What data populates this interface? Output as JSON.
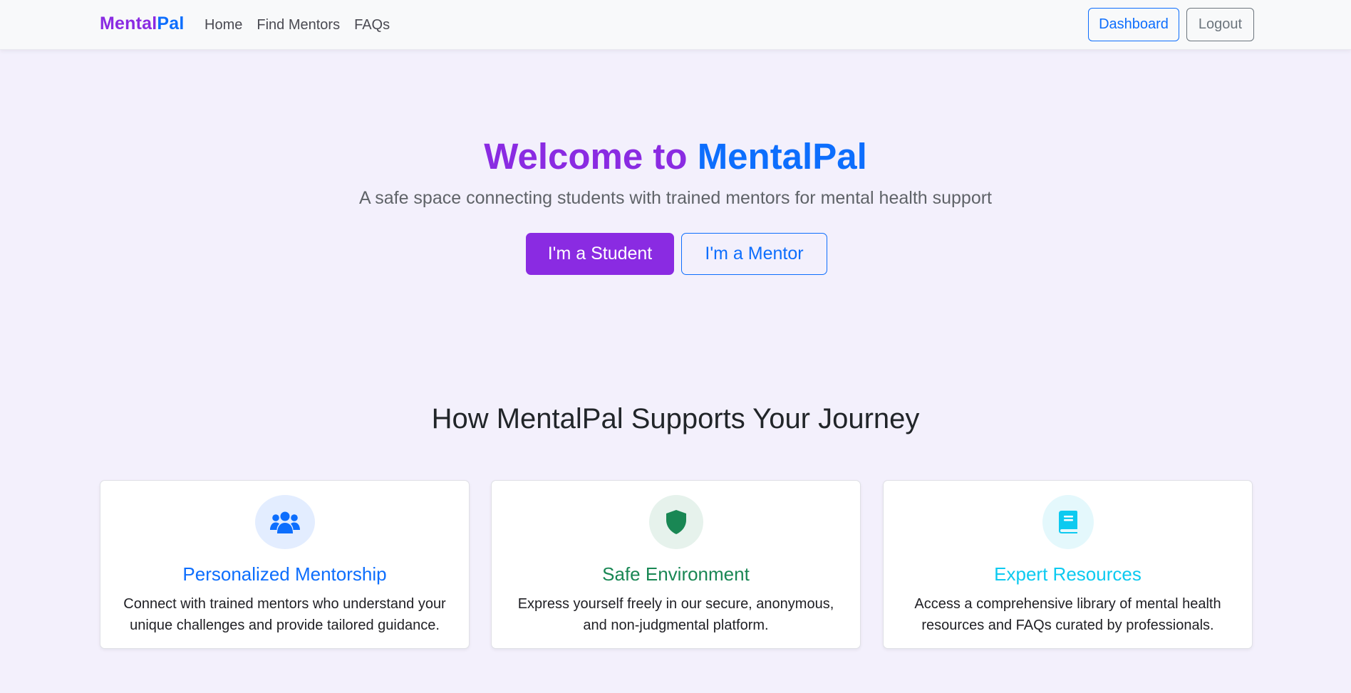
{
  "nav": {
    "brand_part1": "Mental",
    "brand_part2": "Pal",
    "links": [
      "Home",
      "Find Mentors",
      "FAQs"
    ],
    "dashboard_label": "Dashboard",
    "logout_label": "Logout"
  },
  "hero": {
    "title_part1": "Welcome to",
    "title_part2": "MentalPal",
    "subtitle": "A safe space connecting students with trained mentors for mental health support",
    "student_button": "I'm a Student",
    "mentor_button": "I'm a Mentor"
  },
  "features": {
    "heading": "How MentalPal Supports Your Journey",
    "cards": [
      {
        "icon": "users-icon",
        "title": "Personalized Mentorship",
        "text": "Connect with trained mentors who understand your unique challenges and provide tailored guidance.",
        "color": "#0d6efd"
      },
      {
        "icon": "shield-icon",
        "title": "Safe Environment",
        "text": "Express yourself freely in our secure, anonymous, and non-judgmental platform.",
        "color": "#198754"
      },
      {
        "icon": "book-icon",
        "title": "Expert Resources",
        "text": "Access a comprehensive library of mental health resources and FAQs curated by professionals.",
        "color": "#0dcaf0"
      }
    ]
  },
  "colors": {
    "primary_purple": "#8a2be2",
    "primary_blue": "#0d6efd",
    "page_background": "#f3f0fc"
  }
}
